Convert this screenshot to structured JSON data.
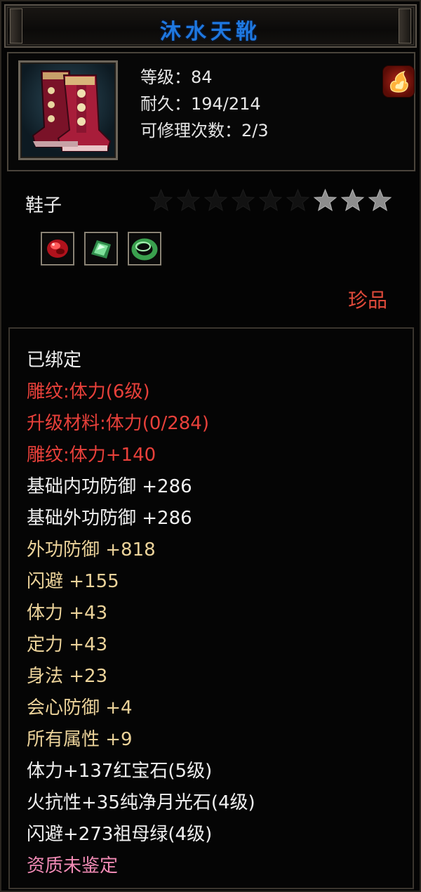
{
  "item": {
    "name": "沐水天靴",
    "level": "等级：84",
    "durability": "耐久：194/214",
    "repairs": "可修理次数：2/3",
    "type": "鞋子",
    "stars": {
      "total": 9,
      "filled": 3
    },
    "rarity": "珍品"
  },
  "gems": [
    {
      "icon": "ruby-gem-icon",
      "color": "#d4222a"
    },
    {
      "icon": "moonstone-gem-icon",
      "color": "#5fc07a"
    },
    {
      "icon": "jade-ring-icon",
      "color": "#3ea050"
    }
  ],
  "attributes": [
    {
      "text": "已绑定",
      "color": "white"
    },
    {
      "text": "雕纹:体力(6级)",
      "color": "red"
    },
    {
      "text": "升级材料:体力(0/284)",
      "color": "red"
    },
    {
      "text": "雕纹:体力+140",
      "color": "red"
    },
    {
      "text": "基础内功防御  +286",
      "color": "white"
    },
    {
      "text": "基础外功防御  +286",
      "color": "white"
    },
    {
      "text": "外功防御  +818",
      "color": "gold"
    },
    {
      "text": "闪避  +155",
      "color": "gold"
    },
    {
      "text": "体力  +43",
      "color": "gold"
    },
    {
      "text": "定力  +43",
      "color": "gold"
    },
    {
      "text": "身法  +23",
      "color": "gold"
    },
    {
      "text": "会心防御  +4",
      "color": "gold"
    },
    {
      "text": "所有属性  +9",
      "color": "gold"
    },
    {
      "text": "体力+137红宝石(5级)",
      "color": "white"
    },
    {
      "text": "火抗性+35纯净月光石(4级)",
      "color": "white"
    },
    {
      "text": "闪避+273祖母绿(4级)",
      "color": "white"
    },
    {
      "text": "资质未鉴定",
      "color": "pink"
    }
  ]
}
